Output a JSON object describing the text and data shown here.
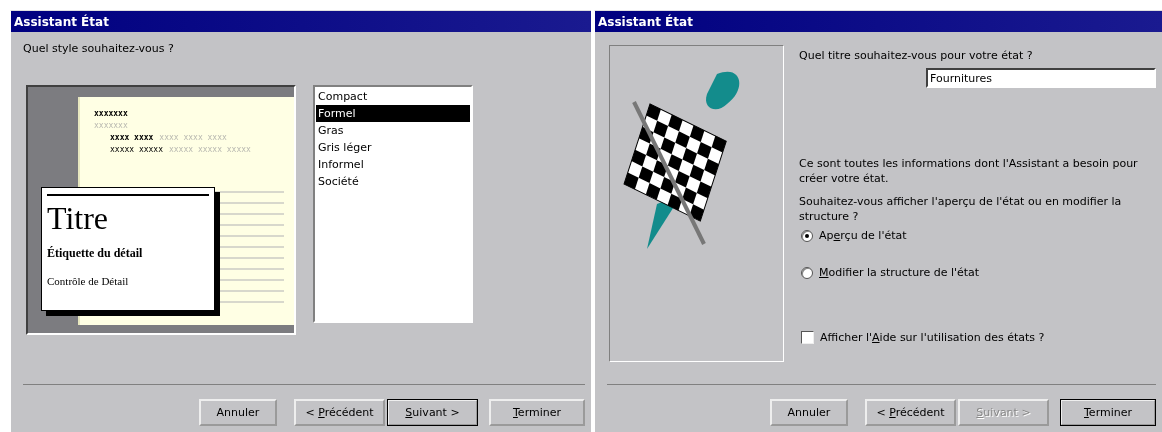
{
  "style_dialog": {
    "title": "Assistant État",
    "question": "Quel style souhaitez-vous ?",
    "preview": {
      "report_title": "xxxxxxx",
      "group_label": "xxxxxxx",
      "column_heads": [
        "xxxx xxxx",
        "xxxx xxxx xxxx"
      ],
      "detail_row": [
        "xxxxx xxxxx",
        "xxxxx xxxxx xxxxx"
      ],
      "card_title": "Titre",
      "card_label": "Étiquette du détail",
      "card_control": "Contrôle de Détail"
    },
    "styles": [
      {
        "label": "Compact",
        "selected": false
      },
      {
        "label": "Formel",
        "selected": true
      },
      {
        "label": "Gras",
        "selected": false
      },
      {
        "label": "Gris léger",
        "selected": false
      },
      {
        "label": "Informel",
        "selected": false
      },
      {
        "label": "Société",
        "selected": false
      }
    ],
    "buttons": [
      {
        "kind": "cancel",
        "label": {
          "before": "Annuler"
        },
        "default": false,
        "disabled": false
      },
      {
        "kind": "back",
        "label": {
          "before": "< ",
          "key": "P",
          "after": "récédent"
        },
        "default": false,
        "disabled": false
      },
      {
        "kind": "next",
        "label": {
          "key": "S",
          "after": "uivant >"
        },
        "default": true,
        "disabled": false
      },
      {
        "kind": "finish",
        "label": {
          "key": "T",
          "after": "erminer"
        },
        "default": false,
        "disabled": false
      }
    ]
  },
  "finish_dialog": {
    "title": "Assistant État",
    "question": "Quel titre souhaitez-vous pour votre état ?",
    "title_field": {
      "value": "Fournitures"
    },
    "info": "Ce sont toutes les informations dont l'Assistant a besoin pour créer votre état.",
    "options_question": "Souhaitez-vous afficher l'aperçu de l'état ou en modifier la structure ?",
    "options": [
      {
        "label": {
          "before": "Ap",
          "key": "e",
          "after": "rçu de l'état"
        },
        "selected": true
      },
      {
        "label": {
          "key": "M",
          "after": "odifier la structure de l'état"
        },
        "selected": false
      }
    ],
    "help_checkbox": {
      "label": {
        "before": "Afficher l'",
        "key": "A",
        "after": "ide sur l'utilisation des états ?"
      },
      "checked": false
    },
    "buttons": [
      {
        "kind": "cancel",
        "label": {
          "before": "Annuler"
        },
        "default": false,
        "disabled": false
      },
      {
        "kind": "back",
        "label": {
          "before": "< ",
          "key": "P",
          "after": "récédent"
        },
        "default": false,
        "disabled": false
      },
      {
        "kind": "next",
        "label": {
          "key": "S",
          "after": "uivant >"
        },
        "default": false,
        "disabled": true
      },
      {
        "kind": "finish",
        "label": {
          "key": "T",
          "after": "erminer"
        },
        "default": true,
        "disabled": false
      }
    ]
  }
}
